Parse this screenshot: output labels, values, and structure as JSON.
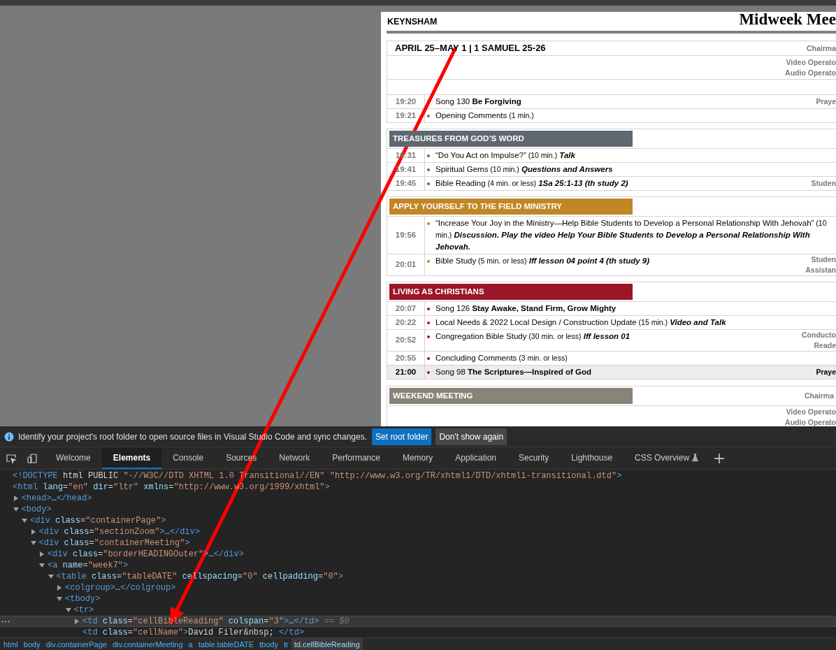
{
  "meeting": {
    "congregation": "KEYNSHAM",
    "title": "Midweek Mee",
    "week": {
      "title": "APRIL 25–MAY 1 | 1 SAMUEL 25-26",
      "roles": [
        "Chairma"
      ],
      "crew_roles": [
        "Video Operato",
        "Audio Operato"
      ],
      "items": [
        {
          "time": "19:20",
          "text": "Song 130 **Be Forgiving**",
          "roles": [
            "Praye"
          ],
          "highlighted": false
        },
        {
          "time": "19:21",
          "text": "Opening Comments",
          "duration": "(1 min.)",
          "highlighted": false
        }
      ]
    },
    "sections": [
      {
        "title": "TREASURES FROM GOD’S WORD",
        "color": "#5f6770",
        "items": [
          {
            "time": "19:31",
            "text": "“Do You Act on Impulse?”",
            "duration": "(10 min.)",
            "note": "Talk",
            "highlighted": false
          },
          {
            "time": "19:41",
            "text": "Spiritual Gems",
            "duration": "(10 min.)",
            "note": "Questions and Answers",
            "highlighted": false
          },
          {
            "time": "19:45",
            "text": "Bible Reading",
            "duration": "(4 min. or less)",
            "note": "1Sa 25:1-13 (th study 2)",
            "roles": [
              "Studen"
            ],
            "highlighted": false
          }
        ]
      },
      {
        "title": "APPLY YOURSELF TO THE FIELD MINISTRY",
        "color": "#c18626",
        "items": [
          {
            "time": "19:56",
            "text": "“Increase Your Joy in the Ministry—Help Bible Students to Develop a Personal Relationship With Jehovah”",
            "duration": "(10 min.)",
            "note": "Discussion. Play the video Help Your Bible Students to Develop a Personal Relationship With Jehovah.",
            "highlighted": false
          },
          {
            "time": "20:01",
            "text": "Bible Study",
            "duration": "(5 min. or less)",
            "note": "lff lesson 04 point 4 (th study 9)",
            "roles": [
              "Studen",
              "Assistan"
            ],
            "highlighted": false
          }
        ]
      },
      {
        "title": "LIVING AS CHRISTIANS",
        "color": "#9a1628",
        "items": [
          {
            "time": "20:07",
            "text": "Song 126 **Stay Awake, Stand Firm, Grow Mighty**",
            "highlighted": false
          },
          {
            "time": "20:22",
            "text": "Local Needs & 2022 Local Design / Construction Update",
            "duration": "(15 min.)",
            "note": "Video and Talk",
            "highlighted": false
          },
          {
            "time": "20:52",
            "text": "Congregation Bible Study",
            "duration": "(30 min. or less)",
            "note": "lff lesson 01",
            "roles": [
              "Conducto",
              "Reade"
            ],
            "highlighted": false
          },
          {
            "time": "20:55",
            "text": "Concluding Comments",
            "duration": "(3 min. or less)",
            "highlighted": false
          },
          {
            "time": "21:00",
            "text": "Song 98 **The Scriptures—Inspired of God**",
            "roles": [
              "Praye"
            ],
            "highlighted": true
          }
        ]
      }
    ],
    "weekend": {
      "title": "WEEKEND MEETING",
      "color": "#8a8378",
      "roles": [
        "Chairma"
      ],
      "crew_roles": [
        "Video Operato",
        "Audio Operato"
      ]
    }
  },
  "devtools": {
    "infobar": {
      "message": "Identify your project's root folder to open source files in Visual Studio Code and sync changes.",
      "buttons": [
        {
          "label": "Set root folder",
          "primary": true
        },
        {
          "label": "Don't show again",
          "primary": false
        }
      ]
    },
    "tabs": [
      {
        "label": "Welcome",
        "selected": false,
        "experimental": false
      },
      {
        "label": "Elements",
        "selected": true,
        "experimental": false
      },
      {
        "label": "Console",
        "selected": false,
        "experimental": false
      },
      {
        "label": "Sources",
        "selected": false,
        "experimental": false
      },
      {
        "label": "Network",
        "selected": false,
        "experimental": false
      },
      {
        "label": "Performance",
        "selected": false,
        "experimental": false
      },
      {
        "label": "Memory",
        "selected": false,
        "experimental": false
      },
      {
        "label": "Application",
        "selected": false,
        "experimental": false
      },
      {
        "label": "Security",
        "selected": false,
        "experimental": false
      },
      {
        "label": "Lighthouse",
        "selected": false,
        "experimental": false
      },
      {
        "label": "CSS Overview",
        "selected": false,
        "experimental": true
      }
    ],
    "dom_tree": [
      {
        "text": "<!DOCTYPE html PUBLIC \"-//W3C//DTD XHTML 1.0 Transitional//EN\" \"http://www.w3.org/TR/xhtml1/DTD/xhtml1-transitional.dtd\">",
        "selected": false
      },
      {
        "text": "<html lang=\"en\" dir=\"ltr\" xmlns=\"http://www.w3.org/1999/xhtml\">",
        "selected": false,
        "children": [
          {
            "text": "<head>…</head>",
            "expanded": false,
            "selected": false
          },
          {
            "text": "<body>",
            "expanded": true,
            "selected": false,
            "children": [
              {
                "text": "<div class=\"containerPage\">",
                "expanded": true,
                "selected": false,
                "children": [
                  {
                    "text": "<div class=\"sectionZoom\">…</div>",
                    "expanded": false,
                    "selected": false
                  },
                  {
                    "text": "<div class=\"containerMeeting\">",
                    "expanded": true,
                    "selected": false,
                    "children": [
                      {
                        "text": "<div class=\"borderHEADINGOuter\">…</div>",
                        "expanded": false,
                        "selected": false
                      },
                      {
                        "text": "<a name=\"week7\">",
                        "expanded": true,
                        "selected": false,
                        "children": [
                          {
                            "text": "<table class=\"tableDATE\" cellspacing=\"0\" cellpadding=\"0\">",
                            "expanded": true,
                            "selected": false,
                            "children": [
                              {
                                "text": "<colgroup>…</colgroup>",
                                "expanded": false,
                                "selected": false
                              },
                              {
                                "text": "<tbody>",
                                "expanded": true,
                                "selected": false,
                                "children": [
                                  {
                                    "text": "<tr>",
                                    "expanded": true,
                                    "selected": false,
                                    "children": [
                                      {
                                        "text": "<td class=\"cellBibleReading\" colspan=\"3\">…</td> == $0",
                                        "expanded": false,
                                        "selected": true
                                      },
                                      {
                                        "text": "<td class=\"cellName\">David Filer&nbsp; </td>",
                                        "selected": false
                                      }
                                    ]
                                  }
                                ]
                              }
                            ]
                          }
                        ]
                      }
                    ]
                  }
                ]
              }
            ]
          }
        ]
      }
    ],
    "breadcrumbs": [
      {
        "label": "html",
        "selected": false
      },
      {
        "label": "body",
        "selected": false
      },
      {
        "label": "div.containerPage",
        "selected": false
      },
      {
        "label": "div.containerMeeting",
        "selected": false
      },
      {
        "label": "a",
        "selected": false
      },
      {
        "label": "table.tableDATE",
        "selected": false
      },
      {
        "label": "tbody",
        "selected": false
      },
      {
        "label": "tr",
        "selected": false
      },
      {
        "label": "td.cellBibleReading",
        "selected": true
      }
    ]
  }
}
